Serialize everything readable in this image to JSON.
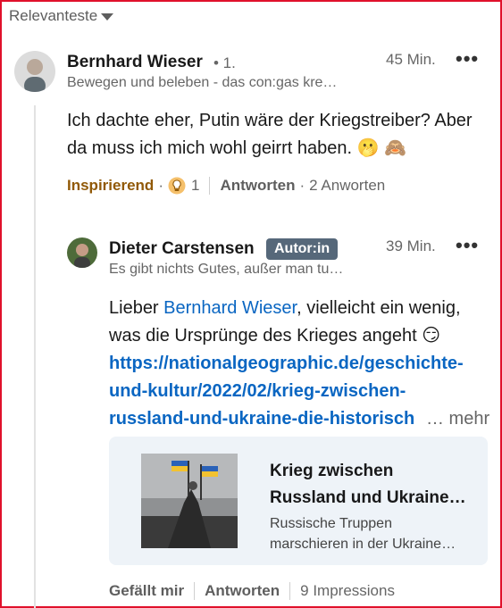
{
  "sort": {
    "label": "Relevanteste"
  },
  "comment": {
    "author": "Bernhard Wieser",
    "degree": "• 1.",
    "headline": "Bewegen und beleben - das con:gas kre…",
    "time": "45 Min.",
    "menu": "•••",
    "text_line1": "Ich dachte eher, Putin wäre der Kriegstreiber? Aber",
    "text_line2": "da muss ich mich wohl geirrt haben. 🫢 🙈",
    "reaction_label": "Inspirierend",
    "reaction_dot": "·",
    "reaction_icon": "lightbulb-icon",
    "reaction_count": "1",
    "reply_label": "Antworten",
    "replies_dot": "·",
    "replies_count": "2 Anworten"
  },
  "reply": {
    "author": "Dieter Carstensen",
    "badge": "Autor:in",
    "headline": "Es gibt nichts Gutes, außer man tu…",
    "time": "39 Min.",
    "menu": "•••",
    "text_prefix": "Lieber ",
    "mention": "Bernhard Wieser",
    "text_line1_rest": ", vielleicht ein wenig,",
    "text_line2": "was die Ursprünge des Krieges angeht 😏",
    "link_line1": "https://nationalgeographic.de/geschichte-",
    "link_line2": "und-kultur/2022/02/krieg-zwischen-",
    "link_line3": "russland-und-ukraine-die-historische",
    "more": "… mehr",
    "card_title_line1": "Krieg zwischen",
    "card_title_line2": "Russland und Ukraine…",
    "card_desc_line1": "Russische Truppen",
    "card_desc_line2": "marschieren in der Ukraine…",
    "like_label": "Gefällt mir",
    "reply_label": "Antworten",
    "impressions": "9 Impressions"
  },
  "colors": {
    "accent": "#0a66c2",
    "border": "#e0112b",
    "badge": "#56687a",
    "inspire": "#915907"
  }
}
